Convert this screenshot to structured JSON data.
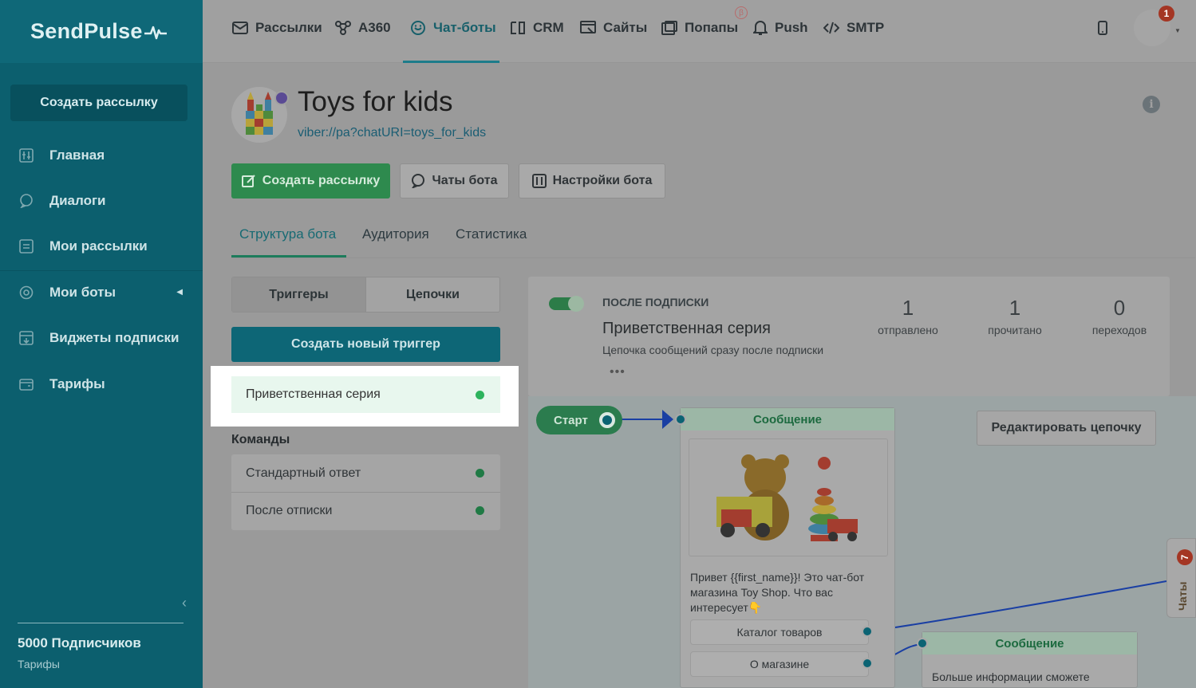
{
  "app": {
    "logo_text": "SendPulse"
  },
  "sidebar": {
    "create_button": "Создать рассылку",
    "items": [
      {
        "label": "Главная",
        "icon": "dashboard-icon"
      },
      {
        "label": "Диалоги",
        "icon": "chat-bubble-icon"
      },
      {
        "label": "Мои рассылки",
        "icon": "mail-list-icon"
      },
      {
        "label": "Мои боты",
        "icon": "bot-icon"
      },
      {
        "label": "Виджеты подписки",
        "icon": "widget-icon"
      },
      {
        "label": "Тарифы",
        "icon": "wallet-icon"
      }
    ],
    "subscribers": "5000 Подписчиков",
    "tariffs_link": "Тарифы"
  },
  "topnav": {
    "items": [
      {
        "label": "Рассылки",
        "icon": "envelope-icon"
      },
      {
        "label": "A360",
        "icon": "network-icon"
      },
      {
        "label": "Чат-боты",
        "icon": "chatbot-icon",
        "active": true
      },
      {
        "label": "CRM",
        "icon": "crm-icon"
      },
      {
        "label": "Сайты",
        "icon": "site-icon"
      },
      {
        "label": "Попапы",
        "icon": "popup-icon"
      },
      {
        "label": "Push",
        "icon": "bell-icon"
      },
      {
        "label": "SMTP",
        "icon": "code-icon"
      }
    ],
    "beta_badge": "β",
    "notifications_count": "1"
  },
  "bot": {
    "title": "Toys for kids",
    "link": "viber://pa?chatURI=toys_for_kids"
  },
  "actions": {
    "create_mailing": "Создать рассылку",
    "bot_chats": "Чаты бота",
    "bot_settings": "Настройки бота"
  },
  "page_tabs": [
    "Структура бота",
    "Аудитория",
    "Статистика"
  ],
  "segment": {
    "triggers": "Триггеры",
    "chains": "Цепочки"
  },
  "create_trigger": "Создать новый триггер",
  "triggers": [
    {
      "label": "Приветственная серия"
    }
  ],
  "commands": {
    "title": "Команды",
    "items": [
      {
        "label": "Стандартный ответ"
      },
      {
        "label": "После отписки"
      }
    ]
  },
  "flow": {
    "tag": "ПОСЛЕ ПОДПИСКИ",
    "name": "Приветственная серия",
    "description": "Цепочка сообщений сразу после подписки",
    "more": "•••",
    "stats": [
      {
        "value": "1",
        "label": "отправлено"
      },
      {
        "value": "1",
        "label": "прочитано"
      },
      {
        "value": "0",
        "label": "переходов"
      }
    ]
  },
  "builder": {
    "start_label": "Старт",
    "edit_chain": "Редактировать цепочку",
    "node1": {
      "header": "Сообщение",
      "text": "Привет {{first_name}}! Это чат-бот магазина Toy Shop. Что вас интересует👇",
      "options": [
        "Каталог товаров",
        "О магазине"
      ]
    },
    "node2": {
      "header": "Сообщение",
      "text": "Больше информации сможете"
    }
  },
  "chats_tab": {
    "label": "Чаты",
    "badge": "7"
  }
}
